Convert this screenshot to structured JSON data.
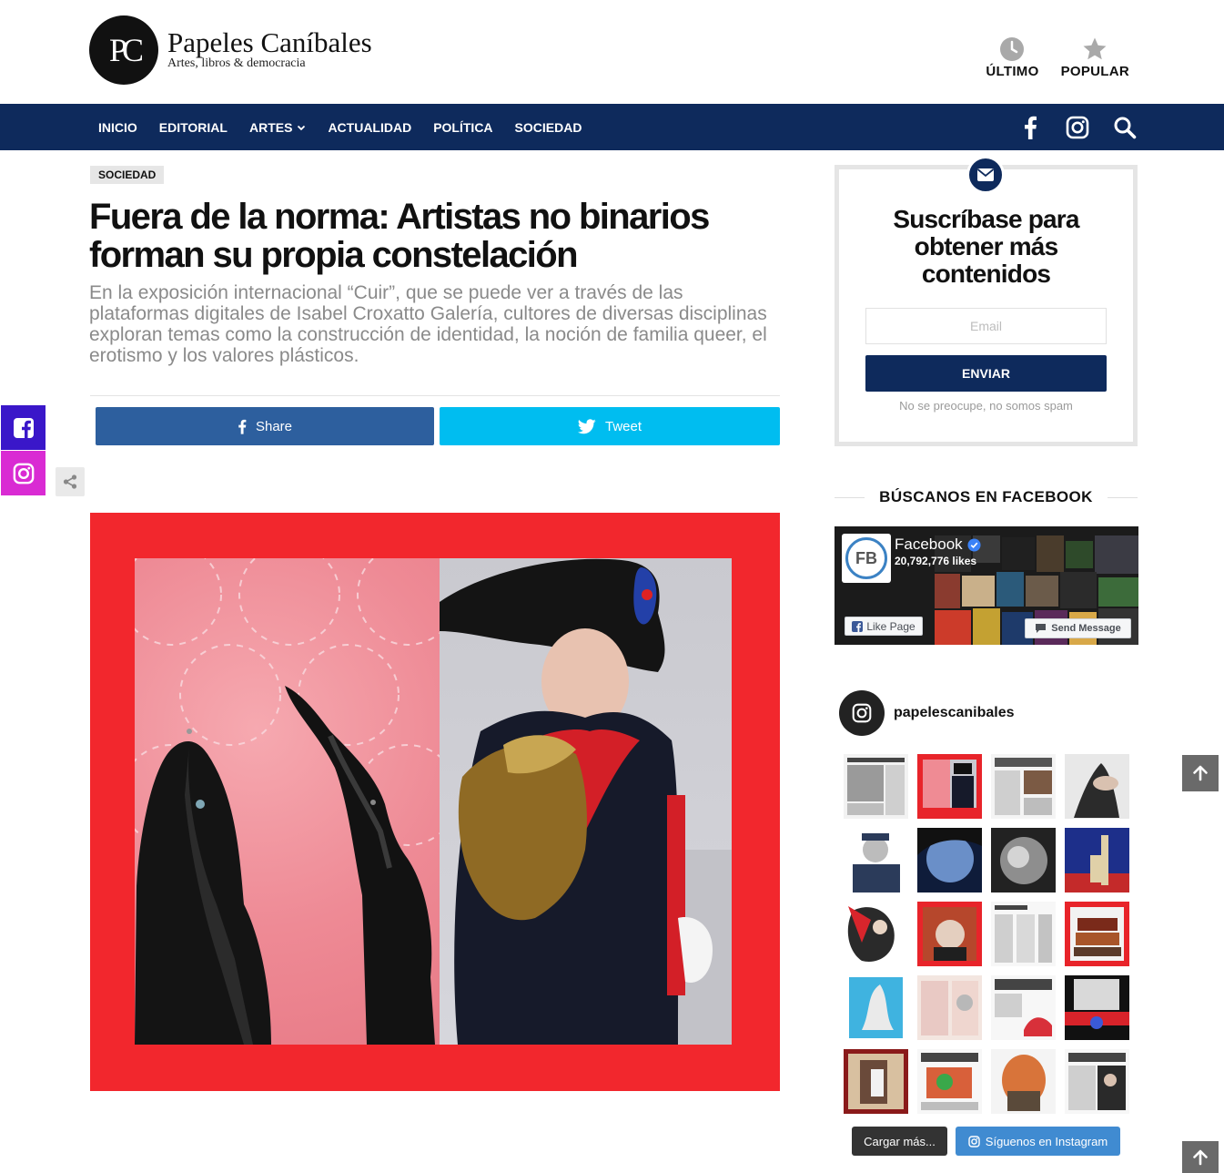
{
  "brand": {
    "logo_letters": "PC",
    "name": "Papeles Caníbales",
    "tagline": "Artes, libros & democracia"
  },
  "header_links": [
    {
      "label": "ÚLTIMO",
      "icon": "clock-icon"
    },
    {
      "label": "POPULAR",
      "icon": "star-icon"
    }
  ],
  "nav": {
    "items": [
      "INICIO",
      "EDITORIAL",
      "ARTES",
      "ACTUALIDAD",
      "POLÍTICA",
      "SOCIEDAD"
    ],
    "dropdown_index": 2,
    "icons": [
      "facebook-icon",
      "instagram-icon",
      "search-icon"
    ],
    "background": "#0e2a5c"
  },
  "article": {
    "category": "SOCIEDAD",
    "title": "Fuera de la norma: Artistas no binarios forman su propia constelación",
    "subtitle": "En la exposición internacional “Cuir”, que se puede ver a través de las plataformas digitales de Isabel Croxatto Galería, cultores de diversas disciplinas exploran temas como la construcción de identidad, la noción de familia queer, el erotismo y los valores plásticos.",
    "share_facebook": "Share",
    "share_twitter": "Tweet",
    "facebook_color": "#2d5f9e",
    "twitter_color": "#00bdf0"
  },
  "subscribe": {
    "title": "Suscríbase para obtener más contenidos",
    "email_placeholder": "Email",
    "button": "ENVIAR",
    "note": "No se preocupe, no somos spam"
  },
  "facebook_widget": {
    "heading": "BÚSCANOS EN FACEBOOK",
    "logo_text": "FB",
    "page_name": "Facebook",
    "likes": "20,792,776 likes",
    "like_button": "Like Page",
    "message_button": "Send Message"
  },
  "instagram": {
    "username": "papelescanibales",
    "load_more": "Cargar más...",
    "follow": "Síguenos en Instagram"
  }
}
